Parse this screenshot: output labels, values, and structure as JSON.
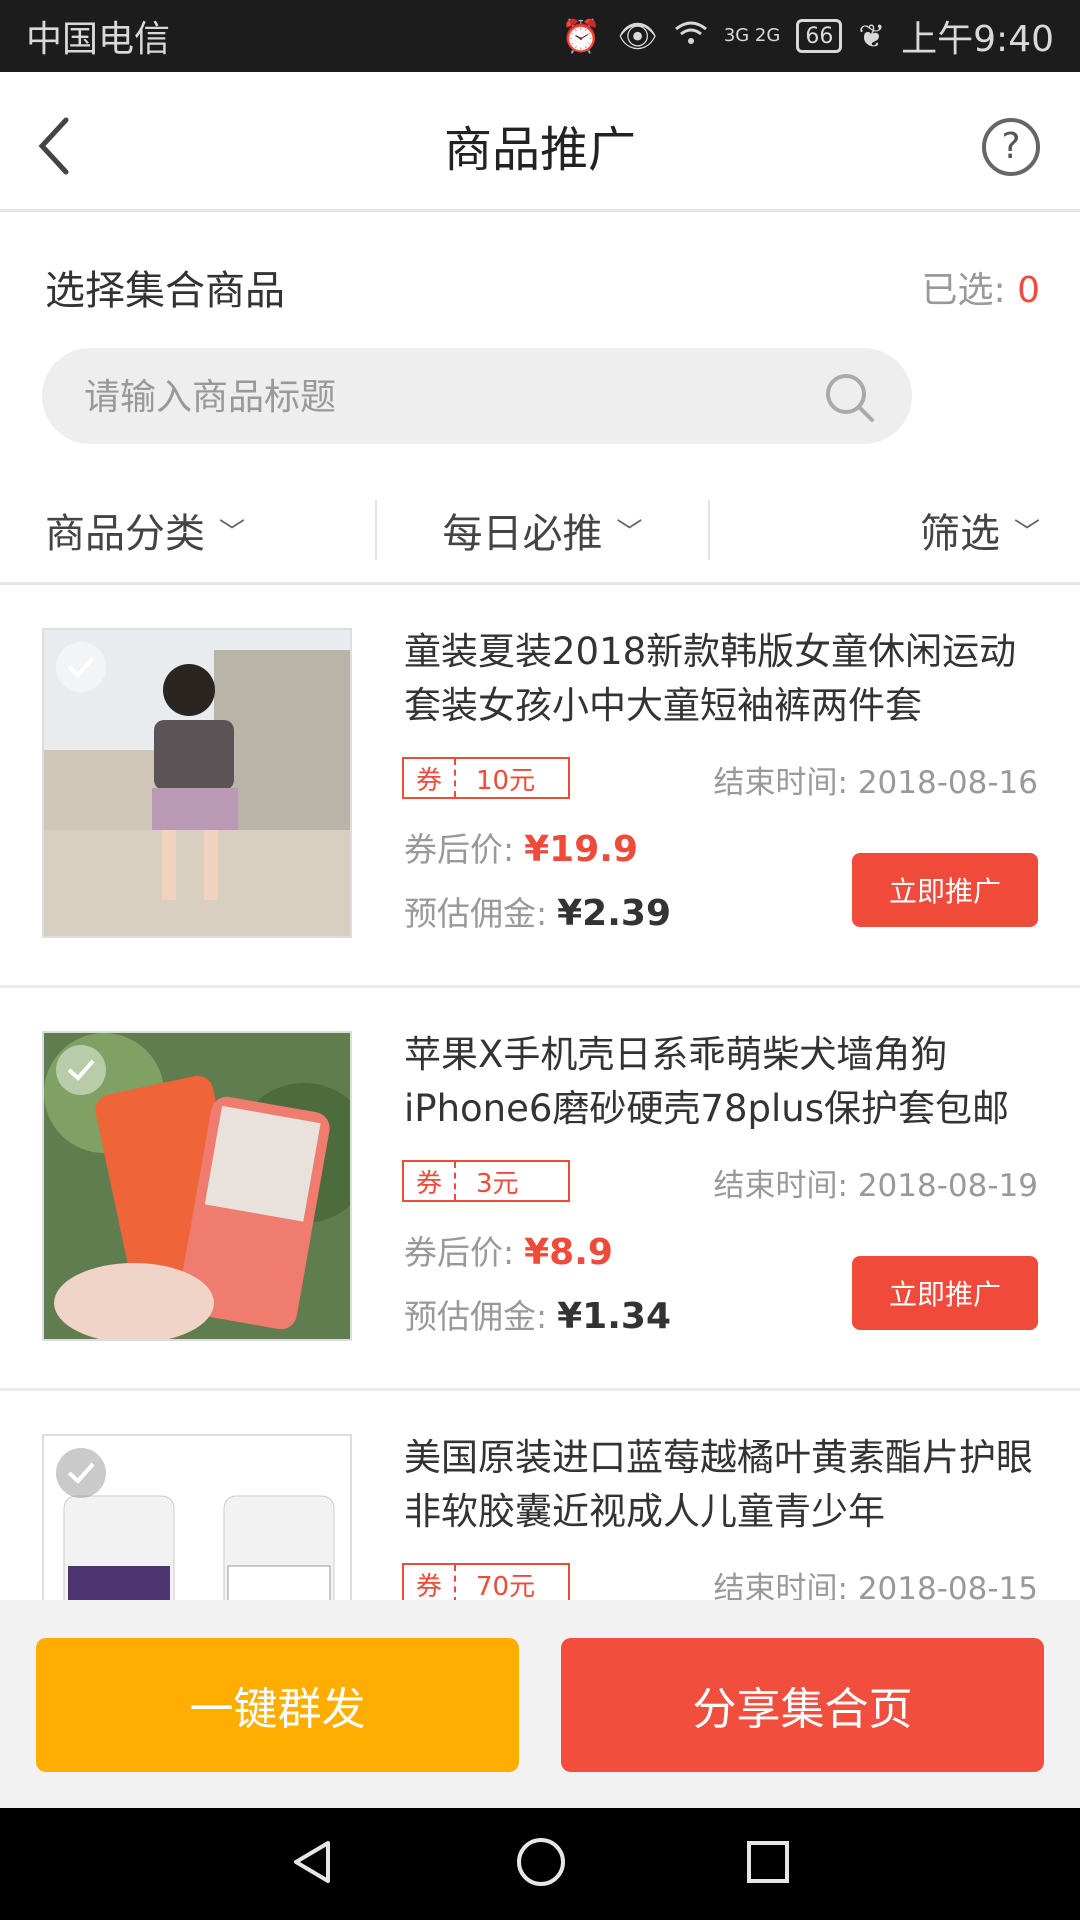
{
  "status_bar": {
    "carrier": "中国电信",
    "network": "3G 2G",
    "battery": "66",
    "time": "上午9:40"
  },
  "header": {
    "title": "商品推广",
    "help_symbol": "?"
  },
  "selection": {
    "title": "选择集合商品",
    "count_label": "已选: ",
    "count": "0"
  },
  "search": {
    "placeholder": "请输入商品标题"
  },
  "filters": [
    {
      "label": "商品分类"
    },
    {
      "label": "每日必推"
    },
    {
      "label": "筛选"
    }
  ],
  "products": [
    {
      "name": "童装夏装2018新款韩版女童休闲运动套装女孩小中大童短袖裤两件套",
      "coupon_tag": "券",
      "coupon_value": "10元",
      "end_time": "结束时间: 2018-08-16",
      "after_label": "券后价:",
      "after_price": "¥19.9",
      "commission_label": "预估佣金:",
      "commission": "¥2.39",
      "button": "立即推广"
    },
    {
      "name": "苹果X手机壳日系乖萌柴犬墙角狗iPhone6磨砂硬壳78plus保护套包邮",
      "coupon_tag": "券",
      "coupon_value": "3元",
      "end_time": "结束时间: 2018-08-19",
      "after_label": "券后价:",
      "after_price": "¥8.9",
      "commission_label": "预估佣金:",
      "commission": "¥1.34",
      "button": "立即推广"
    },
    {
      "name": "美国原装进口蓝莓越橘叶黄素酯片护眼非软胶囊近视成人儿童青少年",
      "coupon_tag": "券",
      "coupon_value": "70元",
      "end_time": "结束时间: 2018-08-15"
    }
  ],
  "bottom_bar": {
    "mass_send": "一键群发",
    "share": "分享集合页"
  },
  "colors": {
    "accent_red": "#f04a3a",
    "accent_orange": "#ffae00"
  }
}
